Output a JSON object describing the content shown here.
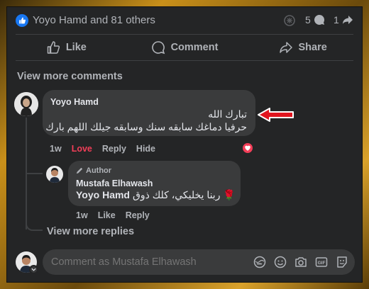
{
  "reactions": {
    "summary": "Yoyo Hamd and 81 others",
    "comments_count": "5",
    "shares_count": "1"
  },
  "actions": {
    "like": "Like",
    "comment": "Comment",
    "share": "Share"
  },
  "view_more_comments": "View more comments",
  "comment": {
    "author": "Yoyo Hamd",
    "line1": "تبارك الله",
    "line2": "حرفيا دماغك سابقه سنك وسابقه جيلك اللهم بارك",
    "time": "1w",
    "reaction_label": "Love",
    "reply": "Reply",
    "hide": "Hide"
  },
  "reply": {
    "badge": "Author",
    "author": "Mustafa Elhawash",
    "mention": "Yoyo Hamd",
    "text": "🌹 ربنا يخليكي، كلك ذوق",
    "time": "1w",
    "like": "Like",
    "reply": "Reply"
  },
  "view_more_replies": "View more replies",
  "composer": {
    "placeholder": "Comment as Mustafa Elhawash"
  },
  "colors": {
    "background": "#242526",
    "bubble": "#3a3b3c",
    "love": "#f33e58",
    "like_blue": "#1877f2",
    "annotation_arrow": "#e0141e"
  },
  "icons": [
    "like-badge-icon",
    "comment-count-icon",
    "share-count-icon",
    "thumbs-up-icon",
    "comment-icon",
    "share-arrow-icon",
    "heart-icon",
    "pencil-icon",
    "avatar-sticker-icon",
    "emoji-icon",
    "camera-icon",
    "gif-icon",
    "sticker-icon"
  ]
}
